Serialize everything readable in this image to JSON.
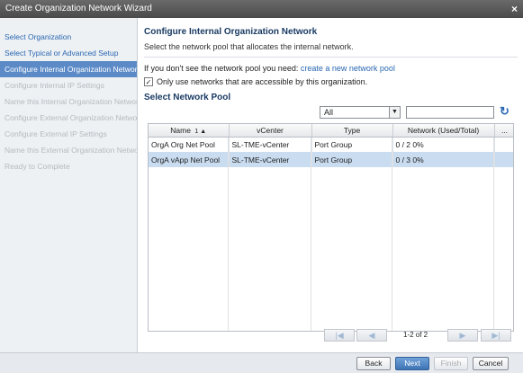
{
  "window": {
    "title": "Create Organization Network Wizard",
    "close_glyph": "×"
  },
  "sidebar": {
    "steps": [
      {
        "label": "Select Organization",
        "state": "link"
      },
      {
        "label": "Select Typical or Advanced Setup",
        "state": "link"
      },
      {
        "label": "Configure Internal Organization Network",
        "state": "active"
      },
      {
        "label": "Configure Internal IP Settings",
        "state": "disabled"
      },
      {
        "label": "Name this Internal Organization Network",
        "state": "disabled"
      },
      {
        "label": "Configure External Organization Network",
        "state": "disabled"
      },
      {
        "label": "Configure External IP Settings",
        "state": "disabled"
      },
      {
        "label": "Name this External Organization Network",
        "state": "disabled"
      },
      {
        "label": "Ready to Complete",
        "state": "disabled"
      }
    ]
  },
  "main": {
    "heading": "Configure Internal Organization Network",
    "subtext": "Select the network pool that allocates the internal network.",
    "need_text": "If you don't see the network pool you need: ",
    "need_link": "create a new network pool",
    "checkbox_label": "Only use networks that are accessible by this organization.",
    "checkbox_checked": true,
    "section_title": "Select Network Pool",
    "filter": {
      "selected": "All",
      "search_value": ""
    },
    "grid": {
      "columns": [
        {
          "label": "Name",
          "sort_index": "1",
          "sort_dir": "▲"
        },
        {
          "label": "vCenter"
        },
        {
          "label": "Type"
        },
        {
          "label": "Network (Used/Total)"
        },
        {
          "label": "..."
        }
      ],
      "rows": [
        {
          "name": "OrgA Org Net Pool",
          "vcenter": "SL-TME-vCenter",
          "type": "Port Group",
          "network": "0 / 2 0%",
          "selected": false
        },
        {
          "name": "OrgA vApp Net Pool",
          "vcenter": "SL-TME-vCenter",
          "type": "Port Group",
          "network": "0 / 3 0%",
          "selected": true
        }
      ]
    },
    "pager": {
      "text": "1-2 of 2"
    }
  },
  "footer": {
    "back": "Back",
    "next": "Next",
    "finish": "Finish",
    "cancel": "Cancel"
  },
  "colors": {
    "accent": "#2a67b1",
    "active_step": "#5b8ac7",
    "selected_row": "#c9dcf0"
  }
}
